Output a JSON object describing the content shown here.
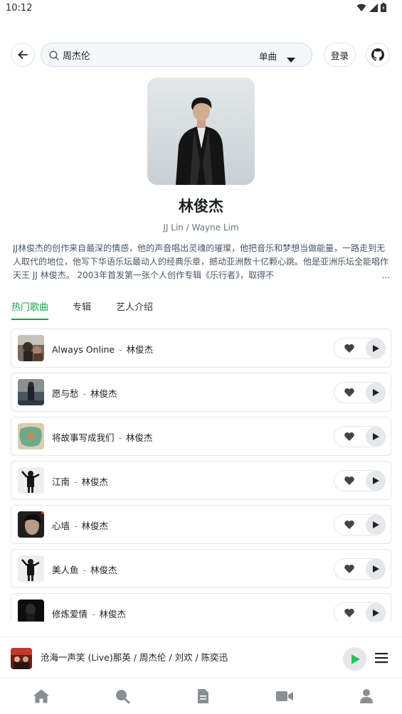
{
  "status_bar": {
    "time": "10:12"
  },
  "header": {
    "search_value": "周杰伦",
    "search_type": "单曲",
    "login_label": "登录"
  },
  "artist": {
    "name": "林俊杰",
    "alias": "JJ Lin / Wayne Lim",
    "description": "JJ林俊杰的创作来自最深的情感，他的声音唱出灵魂的璀璨，他把音乐和梦想当做能量，一路走到无人取代的地位，他写下华语乐坛最动人的经典乐章，撼动亚洲数十亿颗心跳。他是亚洲乐坛全能唱作天王 JJ 林俊杰。 2003年首发第一张个人创作专辑《乐行者》，取得不",
    "ellipsis": "..."
  },
  "tabs": [
    {
      "label": "热门歌曲",
      "active": true
    },
    {
      "label": "专辑",
      "active": false
    },
    {
      "label": "艺人介绍",
      "active": false
    }
  ],
  "songs": [
    {
      "title": "Always Online",
      "artist": "林俊杰",
      "sep": "-"
    },
    {
      "title": "愿与愁",
      "artist": "林俊杰",
      "sep": "-"
    },
    {
      "title": "将故事写成我们",
      "artist": "林俊杰",
      "sep": "-"
    },
    {
      "title": "江南",
      "artist": "林俊杰",
      "sep": "-"
    },
    {
      "title": "心墙",
      "artist": "林俊杰",
      "sep": "-"
    },
    {
      "title": "美人鱼",
      "artist": "林俊杰",
      "sep": "-"
    },
    {
      "title": "修炼爱情",
      "artist": "林俊杰",
      "sep": "-"
    }
  ],
  "player": {
    "now_playing": "沧海一声笑 (Live)那英 / 周杰伦 / 刘欢 / 陈奕迅"
  },
  "colors": {
    "accent": "#16a34a",
    "play_icon": "#22c55e"
  },
  "nav_icons": [
    "home-icon",
    "search-icon",
    "document-icon",
    "video-icon",
    "user-icon"
  ]
}
